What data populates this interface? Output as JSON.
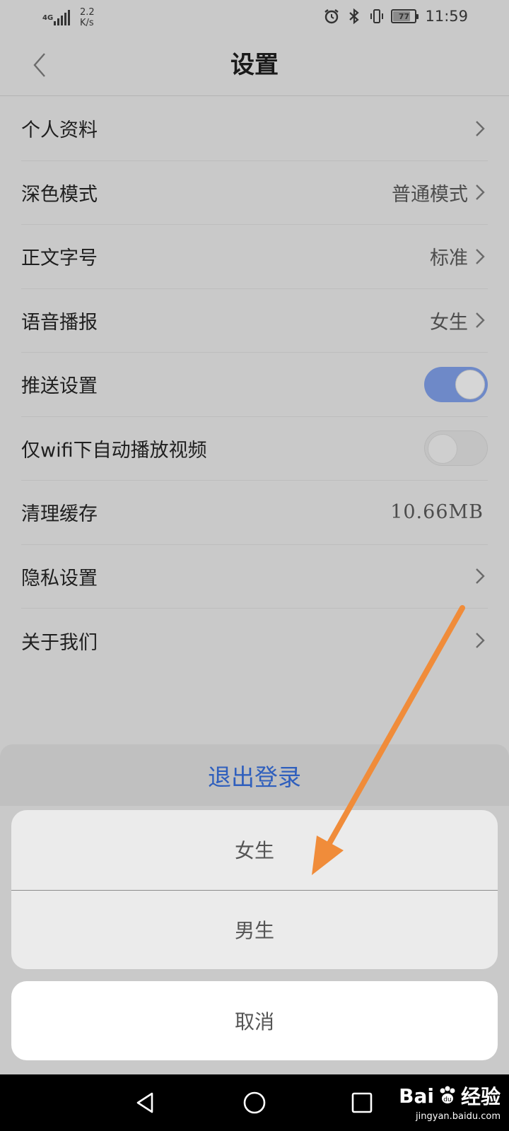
{
  "status_bar": {
    "network_type": "4G",
    "network_speed_value": "2.2",
    "network_speed_unit": "K/s",
    "battery_level": "77",
    "time": "11:59",
    "icons": [
      "alarm-icon",
      "bluetooth-icon",
      "vibrate-icon",
      "battery-icon"
    ]
  },
  "header": {
    "title": "设置",
    "back_icon": "chevron-left-icon"
  },
  "settings": {
    "items": [
      {
        "label": "个人资料",
        "value": "",
        "control": "chevron"
      },
      {
        "label": "深色模式",
        "value": "普通模式",
        "control": "chevron"
      },
      {
        "label": "正文字号",
        "value": "标准",
        "control": "chevron"
      },
      {
        "label": "语音播报",
        "value": "女生",
        "control": "chevron"
      },
      {
        "label": "推送设置",
        "value": "",
        "control": "toggle",
        "checked": true
      },
      {
        "label": "仅wifi下自动播放视频",
        "value": "",
        "control": "toggle",
        "checked": false
      },
      {
        "label": "清理缓存",
        "value": "10.66MB",
        "control": "none"
      },
      {
        "label": "隐私设置",
        "value": "",
        "control": "chevron"
      },
      {
        "label": "关于我们",
        "value": "",
        "control": "chevron"
      }
    ]
  },
  "logout": {
    "label": "退出登录",
    "color": "#2f5fbd"
  },
  "action_sheet": {
    "options": [
      "女生",
      "男生"
    ],
    "cancel": "取消"
  },
  "nav_bar": {
    "back_icon": "triangle-back-icon",
    "home_icon": "circle-home-icon",
    "recents_icon": "square-recents-icon"
  },
  "watermark": {
    "brand": "Bai",
    "brand_suffix": "经验",
    "url": "jingyan.baidu.com"
  },
  "colors": {
    "toggle_on": "#6e89c8",
    "annotation_arrow": "#f08c3a"
  }
}
